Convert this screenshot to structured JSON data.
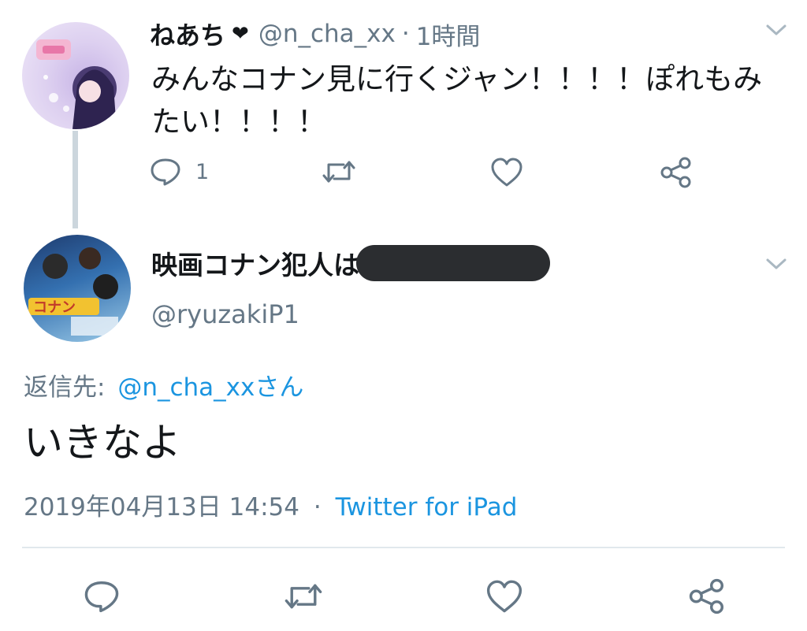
{
  "parent_tweet": {
    "display_name": "ねあち",
    "heart_glyph": "❤",
    "handle": "@n_cha_xx",
    "separator": "·",
    "time": "1時間",
    "text": "みんなコナン見に行くジャン！！！！ぽれもみたい！！！！",
    "reply_count": "1",
    "avatar_icon": "anime-girl-avatar"
  },
  "main_tweet": {
    "display_name": "映画コナン犯人は",
    "handle": "@ryuzakiP1",
    "reply_prefix": "返信先:",
    "reply_to": "@n_cha_xxさん",
    "text": "いきなよ",
    "date": "2019年04月13日 14:54",
    "separator": "·",
    "source": "Twitter for iPad",
    "avatar_icon": "conan-movie-avatar"
  },
  "colors": {
    "text": "#14171a",
    "secondary": "#657786",
    "link": "#1b95e0",
    "divider": "#e1e8ed",
    "redaction": "#2b2d30"
  }
}
